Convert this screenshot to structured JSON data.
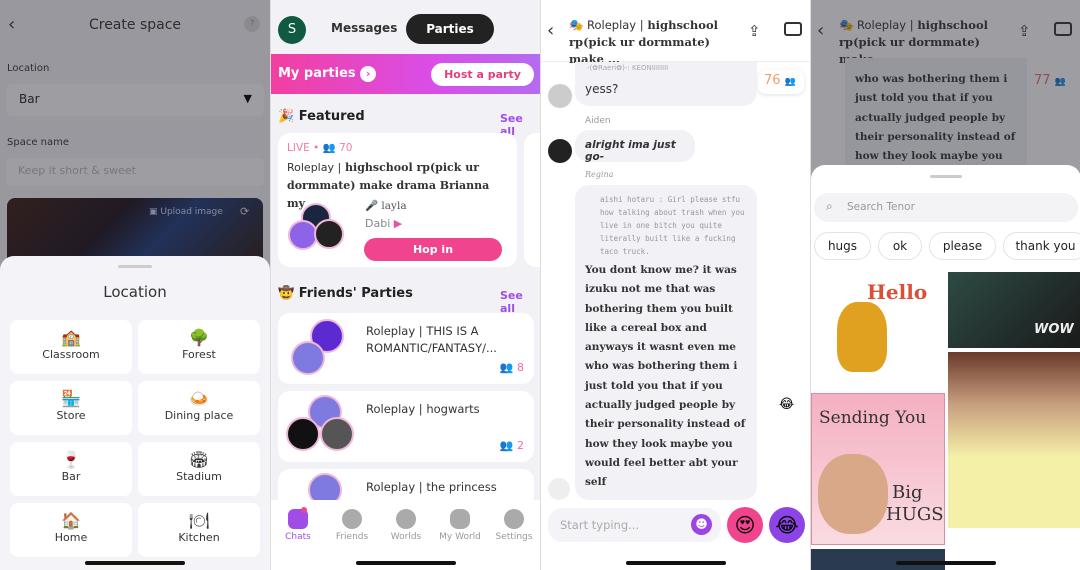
{
  "create_space": {
    "title": "Create space",
    "help": "?",
    "location_label": "Location",
    "location_value": "Bar",
    "space_name_label": "Space name",
    "space_name_placeholder": "Keep it short & sweet",
    "upload_image": "Upload image",
    "sheet_title": "Location",
    "locations": [
      {
        "icon": "🏫",
        "label": "Classroom"
      },
      {
        "icon": "🌳",
        "label": "Forest"
      },
      {
        "icon": "🏪",
        "label": "Store"
      },
      {
        "icon": "🍛",
        "label": "Dining place"
      },
      {
        "icon": "🍷",
        "label": "Bar"
      },
      {
        "icon": "🏟",
        "label": "Stadium"
      },
      {
        "icon": "🏠",
        "label": "Home"
      },
      {
        "icon": "🍽",
        "label": "Kitchen"
      }
    ]
  },
  "parties": {
    "avatar_letter": "S",
    "tabs": [
      "Messages",
      "Parties"
    ],
    "my_parties": "My parties",
    "host_party": "Host a party",
    "featured": {
      "heading": "Featured",
      "see_all": "See all",
      "live": "LIVE",
      "count": "70",
      "category": "Roleplay |",
      "title": "highschool rp(pick ur dormmate) make drama Brianna my ...",
      "host1": "layla",
      "host2": "Dabi",
      "hop_in": "Hop in"
    },
    "friends": {
      "heading": "Friends' Parties",
      "see_all": "See all",
      "items": [
        {
          "title": "Roleplay | THIS IS A ROMANTIC/FANTASY/...",
          "count": "8"
        },
        {
          "title": "Roleplay | hogwarts",
          "count": "2"
        },
        {
          "title": "Roleplay | the princess",
          "count": ""
        }
      ]
    },
    "nav": [
      "Chats",
      "Friends",
      "Worlds",
      "My World",
      "Settings"
    ],
    "accent": "#a04de8",
    "pink": "#f0458e"
  },
  "chat": {
    "title_cat": "Roleplay |",
    "title_rest": "highschool rp(pick ur dormmate) make ...",
    "online": "76",
    "online_after": "77",
    "messages": [
      {
        "reply": "-(✿Raeri✿)-: KEONIIIIIIII",
        "text": "yess?"
      },
      {
        "sender": "Aiden",
        "text": "alright ima  just go-"
      },
      {
        "sender": "Regina",
        "reply": "aishi hotaru : Girl please stfu how talking about trash when you live in one bitch you quite literally built like a fucking taco truck.",
        "text": "You dont know me? it was izuku not me that was bothering them you built like a cereal box and anyways it wasnt even me who was bothering them i just told you that if you actually judged people by their personality instead of how they look maybe you would feel better abt your self"
      }
    ],
    "dim_text": "who was bothering them i just told you that if you actually judged people by their personality instead of how they look maybe you",
    "input_placeholder": "Start typing..."
  },
  "tenor": {
    "search_placeholder": "Search Tenor",
    "chips": [
      "hugs",
      "ok",
      "please",
      "thank you"
    ],
    "gifs": {
      "hello": "Hello",
      "wow": "WOW",
      "sending": "Sending You",
      "big": "Big",
      "hugs": "HUGS"
    }
  }
}
